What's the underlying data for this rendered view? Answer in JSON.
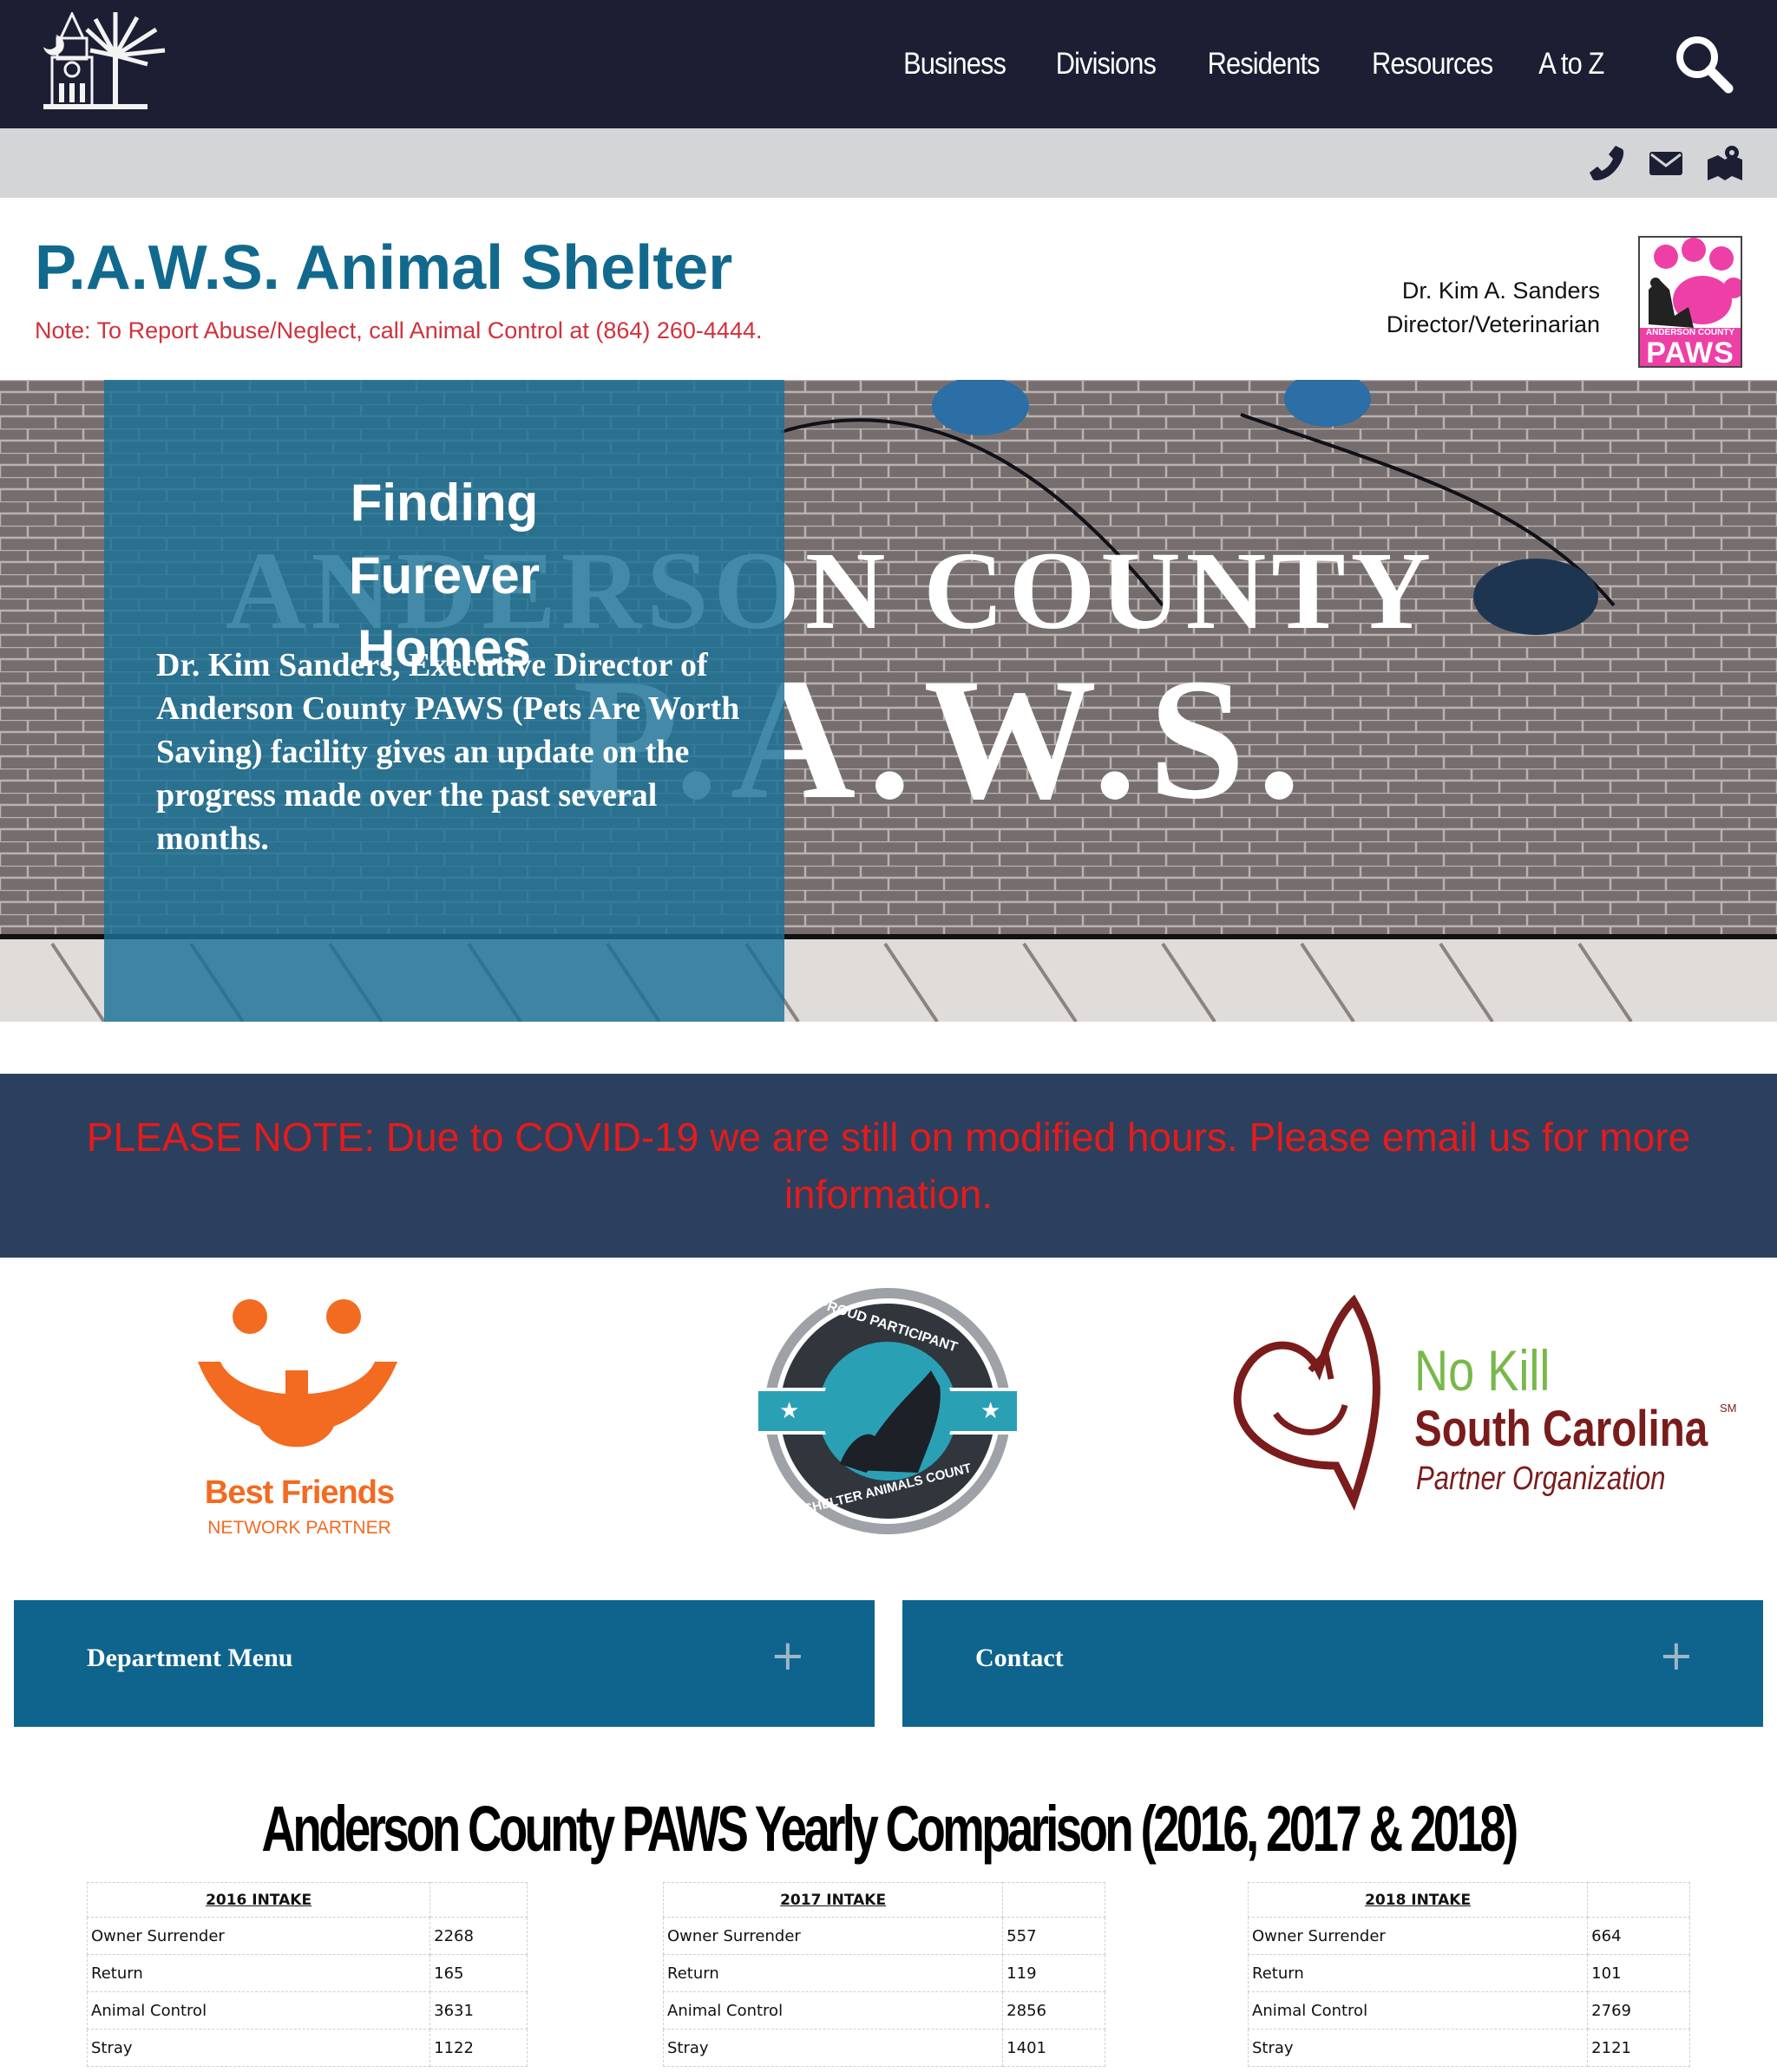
{
  "nav": {
    "items": [
      "Business",
      "Divisions",
      "Residents",
      "Resources",
      "A to Z"
    ],
    "icons": {
      "logo": "county-seal-icon",
      "search": "search-icon"
    }
  },
  "utility_bar": {
    "icons": [
      "phone-icon",
      "email-icon",
      "map-icon"
    ]
  },
  "header": {
    "title": "P.A.W.S. Animal Shelter",
    "note": "Note: To Report Abuse/Neglect, call Animal Control at (864) 260-4444.",
    "director_name": "Dr. Kim A. Sanders",
    "director_role": "Director/Veterinarian",
    "logo_top_text": "ANDERSON COUNTY",
    "logo_text": "PAWS"
  },
  "hero": {
    "title": "Finding Furever Homes",
    "text": "Dr. Kim Sanders, Executive Director of Anderson County PAWS (Pets Are Worth Saving) facility gives an update on the progress made over the past several months.",
    "sign_line1": "ANDERSON COUNTY",
    "sign_line2": "P.A.W.S."
  },
  "covid": {
    "text": "PLEASE NOTE: Due to COVID-19 we are still on modified hours. Please email us for more information."
  },
  "partners": {
    "best_friends": {
      "name": "Best Friends",
      "sub": "NETWORK PARTNER"
    },
    "shelter_count": {
      "top": "PROUD PARTICIPANT",
      "bottom": "SHELTER ANIMALS COUNT"
    },
    "no_kill": {
      "line1": "No Kill",
      "line2": "South Carolina",
      "mark": "SM",
      "line3": "Partner Organization"
    }
  },
  "accordions": {
    "department_menu": "Department Menu",
    "contact": "Contact",
    "plus": "+"
  },
  "comparison": {
    "title": "Anderson County PAWS Yearly Comparison (2016, 2017 & 2018)",
    "tables": [
      {
        "header": "2016 INTAKE",
        "rows": [
          {
            "label": "Owner Surrender",
            "value": "2268"
          },
          {
            "label": "Return",
            "value": "165"
          },
          {
            "label": "Animal Control",
            "value": "3631"
          },
          {
            "label": "Stray",
            "value": "1122"
          }
        ]
      },
      {
        "header": "2017 INTAKE",
        "rows": [
          {
            "label": "Owner Surrender",
            "value": "557"
          },
          {
            "label": "Return",
            "value": "119"
          },
          {
            "label": "Animal Control",
            "value": "2856"
          },
          {
            "label": "Stray",
            "value": "1401"
          }
        ]
      },
      {
        "header": "2018 INTAKE",
        "rows": [
          {
            "label": "Owner Surrender",
            "value": "664"
          },
          {
            "label": "Return",
            "value": "101"
          },
          {
            "label": "Animal Control",
            "value": "2769"
          },
          {
            "label": "Stray",
            "value": "2121"
          }
        ]
      }
    ]
  },
  "colors": {
    "nav_bg": "#1c1f33",
    "title_blue": "#12698e",
    "alert_red": "#e51b1b",
    "accordion_blue": "#0f648d",
    "covid_bg": "#2b405e"
  }
}
